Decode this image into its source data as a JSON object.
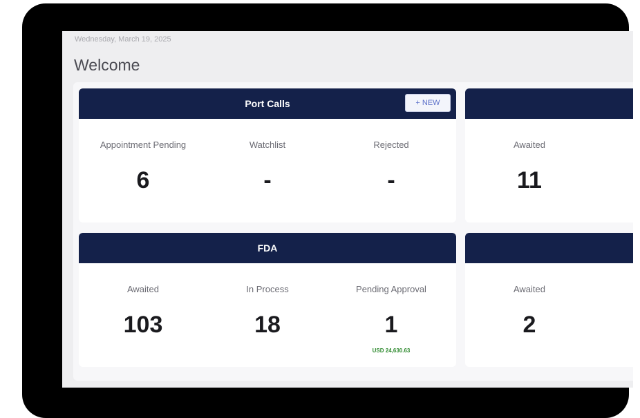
{
  "header": {
    "date": "Wednesday, March 19, 2025",
    "welcome": "Welcome"
  },
  "cards": {
    "port_calls": {
      "title": "Port Calls",
      "new_button": "+ NEW",
      "stats": [
        {
          "label": "Appointment Pending",
          "value": "6"
        },
        {
          "label": "Watchlist",
          "value": "-"
        },
        {
          "label": "Rejected",
          "value": "-"
        }
      ]
    },
    "top_right": {
      "title": "",
      "stats": [
        {
          "label": "Awaited",
          "value": "11"
        }
      ]
    },
    "fda": {
      "title": "FDA",
      "stats": [
        {
          "label": "Awaited",
          "value": "103"
        },
        {
          "label": "In Process",
          "value": "18"
        },
        {
          "label": "Pending Approval",
          "value": "1",
          "sub": "USD 24,630.63"
        }
      ]
    },
    "bottom_right": {
      "title": "",
      "stats": [
        {
          "label": "Awaited",
          "value": "2"
        }
      ]
    }
  },
  "colors": {
    "header_bg": "#14214a",
    "device_frame": "#000000",
    "amount_text": "#2f8a2f"
  }
}
